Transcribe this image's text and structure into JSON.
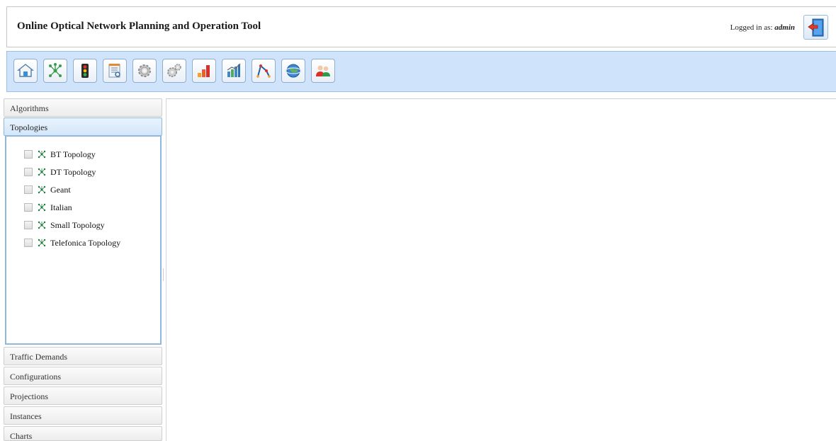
{
  "header": {
    "title": "Online Optical Network Planning and Operation Tool",
    "login_prefix": "Logged in as:",
    "username": "admin"
  },
  "toolbar": {
    "buttons": [
      {
        "icon": "home-icon"
      },
      {
        "icon": "topology-icon"
      },
      {
        "icon": "traffic-light-icon"
      },
      {
        "icon": "document-icon"
      },
      {
        "icon": "gear-icon"
      },
      {
        "icon": "gears-icon"
      },
      {
        "icon": "bar-chart-icon"
      },
      {
        "icon": "statistics-icon"
      },
      {
        "icon": "path-icon"
      },
      {
        "icon": "globe-icon"
      },
      {
        "icon": "users-icon"
      }
    ]
  },
  "accordion": {
    "sections": [
      "Algorithms",
      "Topologies",
      "Traffic Demands",
      "Configurations",
      "Projections",
      "Instances",
      "Charts"
    ],
    "active": "Topologies",
    "topologies": [
      "BT Topology",
      "DT Topology",
      "Geant",
      "Italian",
      "Small Topology",
      "Telefonica Topology"
    ]
  },
  "colors": {
    "toolbar_bg": "#cfe4fa",
    "accent_border": "#8fb8df",
    "topology_icon": "#1e7a3c"
  }
}
